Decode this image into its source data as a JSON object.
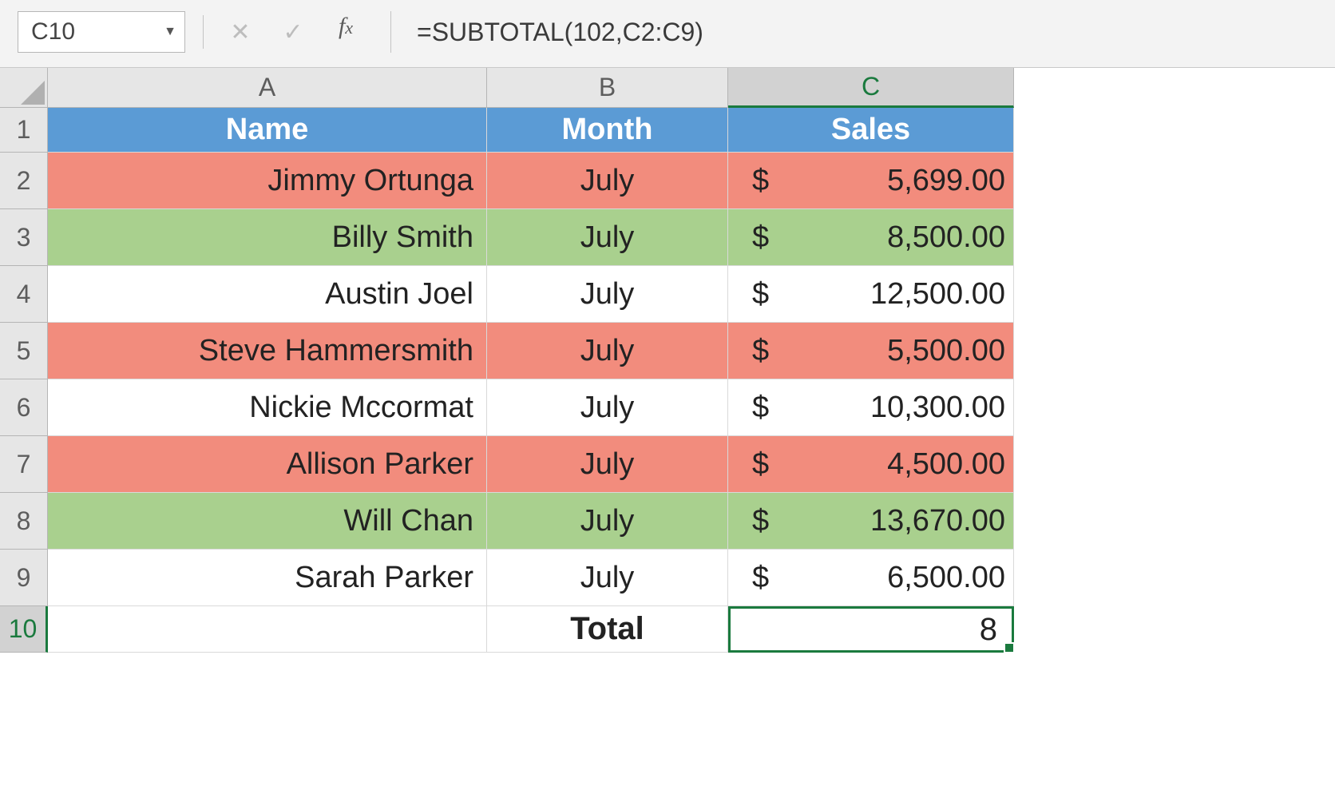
{
  "formula_bar": {
    "name_box": "C10",
    "formula": "=SUBTOTAL(102,C2:C9)"
  },
  "columns": [
    "A",
    "B",
    "C"
  ],
  "header_row_number": "1",
  "headers": {
    "name": "Name",
    "month": "Month",
    "sales": "Sales"
  },
  "rows": [
    {
      "n": "2",
      "name": "Jimmy Ortunga",
      "month": "July",
      "cur": "$",
      "sales": "5,699.00",
      "color": "salmon"
    },
    {
      "n": "3",
      "name": "Billy Smith",
      "month": "July",
      "cur": "$",
      "sales": "8,500.00",
      "color": "green"
    },
    {
      "n": "4",
      "name": "Austin Joel",
      "month": "July",
      "cur": "$",
      "sales": "12,500.00",
      "color": "white"
    },
    {
      "n": "5",
      "name": "Steve Hammersmith",
      "month": "July",
      "cur": "$",
      "sales": "5,500.00",
      "color": "salmon"
    },
    {
      "n": "6",
      "name": "Nickie Mccormat",
      "month": "July",
      "cur": "$",
      "sales": "10,300.00",
      "color": "white"
    },
    {
      "n": "7",
      "name": "Allison Parker",
      "month": "July",
      "cur": "$",
      "sales": "4,500.00",
      "color": "salmon"
    },
    {
      "n": "8",
      "name": "Will Chan",
      "month": "July",
      "cur": "$",
      "sales": "13,670.00",
      "color": "green"
    },
    {
      "n": "9",
      "name": "Sarah Parker",
      "month": "July",
      "cur": "$",
      "sales": "6,500.00",
      "color": "white"
    }
  ],
  "total_row": {
    "n": "10",
    "label": "Total",
    "value": "8"
  },
  "colors": {
    "header_blue": "#5b9bd5",
    "salmon": "#f28c7d",
    "green": "#a9d08e",
    "selection_green": "#1a7a3e"
  },
  "chart_data": {
    "type": "table",
    "columns": [
      "Name",
      "Month",
      "Sales"
    ],
    "rows": [
      [
        "Jimmy Ortunga",
        "July",
        5699.0
      ],
      [
        "Billy Smith",
        "July",
        8500.0
      ],
      [
        "Austin Joel",
        "July",
        12500.0
      ],
      [
        "Steve Hammersmith",
        "July",
        5500.0
      ],
      [
        "Nickie Mccormat",
        "July",
        10300.0
      ],
      [
        "Allison Parker",
        "July",
        4500.0
      ],
      [
        "Will Chan",
        "July",
        13670.0
      ],
      [
        "Sarah Parker",
        "July",
        6500.0
      ]
    ],
    "total": {
      "label": "Total",
      "value": 8
    }
  }
}
